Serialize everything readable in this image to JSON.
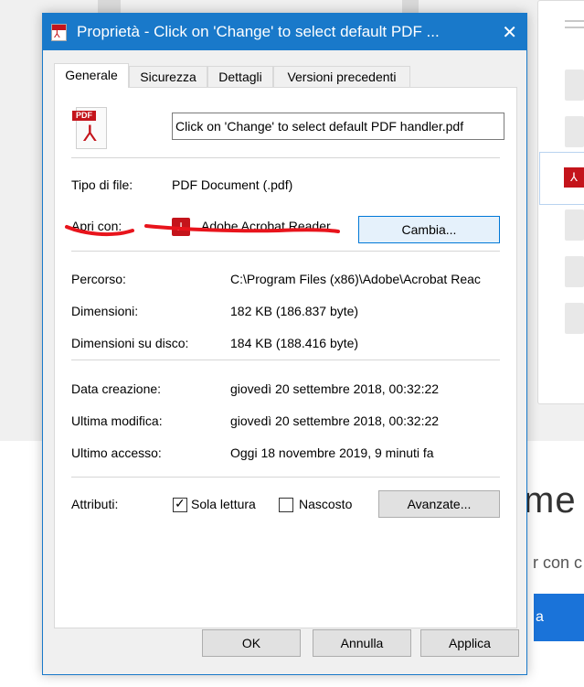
{
  "background": {
    "headline_fragment": "me",
    "subtext_fragment": "r con c",
    "button_fragment": "a"
  },
  "dialog": {
    "title": "Proprietà - Click on 'Change' to select default PDF ...",
    "close_glyph": "✕",
    "tabs": [
      {
        "label": "Generale",
        "active": true
      },
      {
        "label": "Sicurezza",
        "active": false
      },
      {
        "label": "Dettagli",
        "active": false
      },
      {
        "label": "Versioni precedenti",
        "active": false
      }
    ],
    "file_icon": {
      "band_text": "PDF",
      "glyph": "⅄"
    },
    "filename": "Click on 'Change' to select default PDF handler.pdf",
    "file_type_label": "Tipo di file:",
    "file_type_value": "PDF Document (.pdf)",
    "opens_with_label": "Apri con:",
    "opens_with_value": "Adobe Acrobat Reader",
    "change_button": "Cambia...",
    "path_label": "Percorso:",
    "path_value": "C:\\Program Files (x86)\\Adobe\\Acrobat Reac",
    "size_label": "Dimensioni:",
    "size_value": "182 KB (186.837 byte)",
    "size_on_disk_label": "Dimensioni su disco:",
    "size_on_disk_value": "184 KB (188.416 byte)",
    "created_label": "Data creazione:",
    "created_value": "giovedì 20 settembre 2018, 00:32:22",
    "modified_label": "Ultima modifica:",
    "modified_value": "giovedì 20 settembre 2018, 00:32:22",
    "accessed_label": "Ultimo accesso:",
    "accessed_value": "Oggi 18 novembre 2019, 9 minuti fa",
    "attributes_label": "Attributi:",
    "readonly_label": "Sola lettura",
    "readonly_checked": true,
    "hidden_label": "Nascosto",
    "hidden_checked": false,
    "advanced_button": "Avanzate...",
    "ok_button": "OK",
    "cancel_button": "Annulla",
    "apply_button": "Applica"
  },
  "colors": {
    "titlebar": "#1979ca",
    "pdf_red": "#c4141b",
    "annotation_red": "#e8141c"
  }
}
